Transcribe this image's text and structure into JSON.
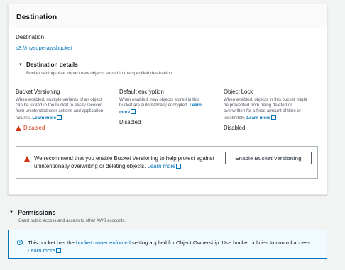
{
  "destination": {
    "header": "Destination",
    "label": "Destination",
    "bucket_link": "s3://mysuperawsbucket",
    "details": {
      "title": "Destination details",
      "description": "Bucket settings that impact new objects stored in the specified destination."
    },
    "columns": {
      "versioning": {
        "title": "Bucket Versioning",
        "description": "When enabled, multiple variants of an object can be stored in the bucket to easily recover from unintended user actions and application failures.",
        "learn_more": "Learn more",
        "status": "Disabled"
      },
      "encryption": {
        "title": "Default encryption",
        "description": "When enabled, new objects stored in this bucket are automatically encrypted.",
        "learn_more": "Learn more",
        "status": "Disabled"
      },
      "object_lock": {
        "title": "Object Lock",
        "description": "When enabled, objects in this bucket might be prevented from being deleted or overwritten for a fixed amount of time or indefinitely.",
        "learn_more": "Learn more",
        "status": "Disabled"
      }
    },
    "alert": {
      "text": "We recommend that you enable Bucket Versioning to help protect against unintentionally overwriting or deleting objects.",
      "learn_more": "Learn more",
      "button_label": "Enable Bucket Versioning"
    }
  },
  "permissions": {
    "title": "Permissions",
    "description": "Grant public access and access to other AWS accounts.",
    "info": {
      "prefix": "This bucket has the ",
      "link": "bucket owner enforced",
      "suffix": " setting applied for Object Ownership. Use bucket policies to control access.",
      "learn_more": "Learn more"
    }
  },
  "colors": {
    "link": "#0073bb",
    "error": "#d13212",
    "info_bg": "#f1faff"
  }
}
